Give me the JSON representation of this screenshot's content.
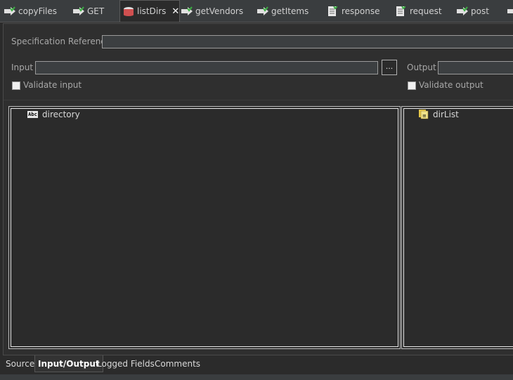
{
  "tabs": [
    {
      "label": "copyFiles",
      "icon": "service-icon"
    },
    {
      "label": "GET",
      "icon": "service-icon"
    },
    {
      "label": "listDirs",
      "icon": "java-service-icon",
      "active": true,
      "close": "✕"
    },
    {
      "label": "getVendors",
      "icon": "service-icon"
    },
    {
      "label": "getItems",
      "icon": "service-icon"
    },
    {
      "label": "response",
      "icon": "document-icon"
    },
    {
      "label": "request",
      "icon": "document-icon"
    },
    {
      "label": "post",
      "icon": "service-icon"
    }
  ],
  "form": {
    "spec_ref_label": "Specification Reference",
    "spec_ref_value": "",
    "input_label": "Input",
    "input_value": "",
    "browse_label": "...",
    "output_label": "Output",
    "output_value": "",
    "validate_input_label": "Validate input",
    "validate_output_label": "Validate output"
  },
  "input_tree": {
    "items": [
      {
        "label": "directory",
        "icon": "string-icon",
        "icon_text": "Abc"
      }
    ]
  },
  "output_tree": {
    "items": [
      {
        "label": "dirList",
        "icon": "string-list-icon"
      }
    ]
  },
  "bottom_tabs": [
    {
      "label": "Source"
    },
    {
      "label": "Input/Output",
      "active": true
    },
    {
      "label": "Logged Fields"
    },
    {
      "label": "Comments"
    }
  ],
  "colors": {
    "accent_green": "#4caf50",
    "background": "#2b2b2b"
  }
}
